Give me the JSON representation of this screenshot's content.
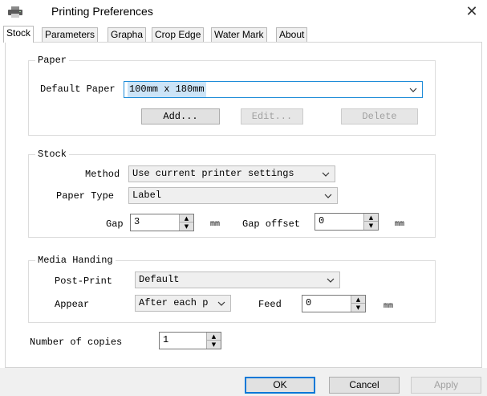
{
  "window": {
    "title": "Printing Preferences",
    "close_glyph": "✕",
    "title_icon": "printer-icon"
  },
  "tabs": [
    {
      "label": "Stock",
      "active": true
    },
    {
      "label": "Parameters",
      "active": false
    },
    {
      "label": "Grapha",
      "active": false
    },
    {
      "label": "Crop Edge",
      "active": false
    },
    {
      "label": "Water Mark",
      "active": false
    },
    {
      "label": "About",
      "active": false
    }
  ],
  "paper": {
    "legend": "Paper",
    "default_label": "Default Paper",
    "default_value": "100mm x 180mm",
    "add_label": "Add...",
    "edit_label": "Edit...",
    "delete_label": "Delete"
  },
  "stock": {
    "legend": "Stock",
    "method_label": "Method",
    "method_value": "Use current printer settings",
    "paper_type_label": "Paper Type",
    "paper_type_value": "Label",
    "gap_label": "Gap",
    "gap_value": "3",
    "gap_unit": "mm",
    "gap_offset_label": "Gap offset",
    "gap_offset_value": "0",
    "gap_offset_unit": "mm"
  },
  "media": {
    "legend": "Media Handing",
    "post_print_label": "Post-Print",
    "post_print_value": "Default",
    "appear_label": "Appear",
    "appear_value": "After each p",
    "feed_label": "Feed",
    "feed_value": "0",
    "feed_unit": "mm"
  },
  "copies": {
    "label": "Number of copies",
    "value": "1"
  },
  "footer": {
    "ok_label": "OK",
    "cancel_label": "Cancel",
    "apply_label": "Apply"
  },
  "colors": {
    "accent": "#0078d7",
    "selection": "#cce4f7",
    "footer_bg": "#f0f0f0"
  }
}
